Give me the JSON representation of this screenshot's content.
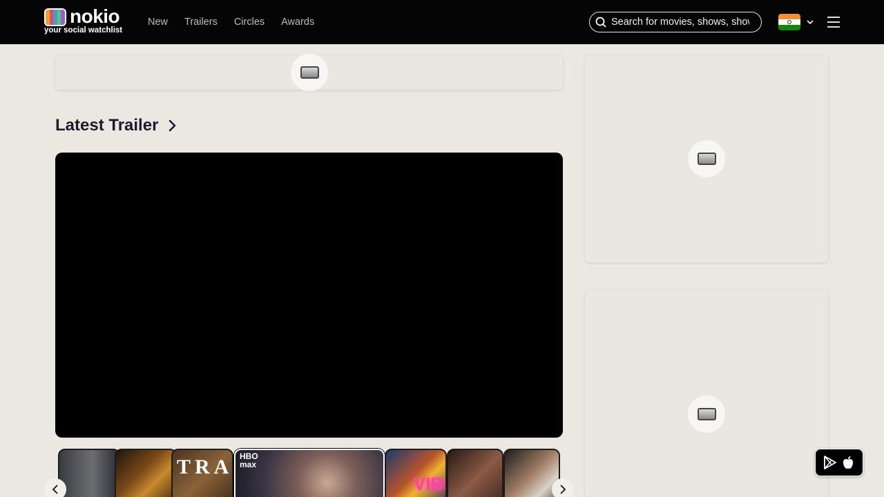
{
  "brand": {
    "name": "nokio",
    "tagline": "your social watchlist"
  },
  "nav": {
    "items": [
      {
        "label": "New"
      },
      {
        "label": "Trailers"
      },
      {
        "label": "Circles"
      },
      {
        "label": "Awards"
      }
    ]
  },
  "search": {
    "placeholder": "Search for movies, shows, shows"
  },
  "language": {
    "flag": "india-flag-icon"
  },
  "main": {
    "section_title": "Latest Trailer"
  },
  "carousel": {
    "thumbnails": [
      {
        "text": ""
      },
      {
        "text": ""
      },
      {
        "text": "TRAIL"
      },
      {
        "text": "HBO max",
        "active": true
      },
      {
        "text": "VIBE"
      },
      {
        "text": ""
      },
      {
        "text": ""
      }
    ]
  },
  "colors": {
    "header_bg": "#050505",
    "page_bg": "#ebe8e2",
    "title_text": "#1b1a2e"
  }
}
